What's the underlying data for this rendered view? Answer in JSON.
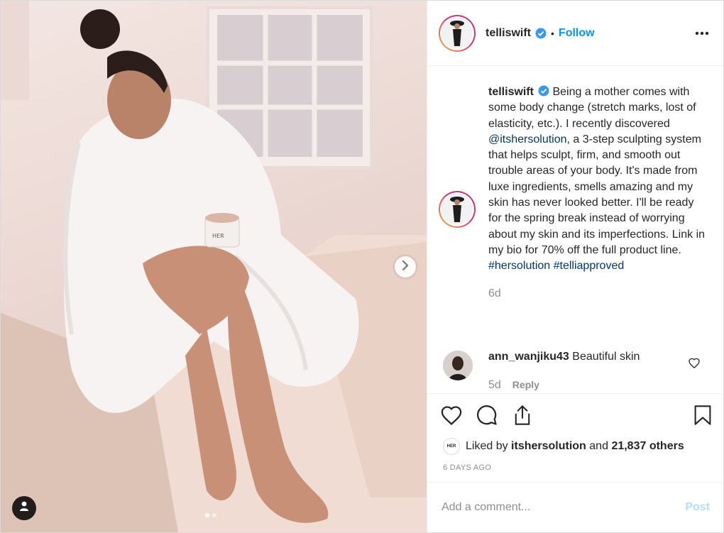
{
  "post": {
    "username": "telliswift",
    "follow_label": "Follow",
    "separator": "•",
    "caption": {
      "username": "telliswift",
      "text_1": " Being a mother comes with some body change (stretch marks, lost of elasticity, etc.). I recently discovered ",
      "mention": "@itshersolution",
      "text_2": ", a 3-step sculpting system that helps sculpt, firm, and smooth out trouble areas of your body. It's made from luxe ingredients, smells amazing and my skin has never looked better. I'll be ready for the spring break instead of worrying about my skin and its imperfections. Link in my bio for 70% off the full product line. ",
      "hashtag_1": "#hersolution",
      "hashtag_2": "#telliapproved",
      "time": "6d"
    },
    "comment": {
      "username": "ann_wanjiku43",
      "text": " Beautiful skin",
      "time": "5d",
      "reply_label": "Reply"
    },
    "likes": {
      "mini_logo": "HER",
      "prefix": "Liked by ",
      "user": "itshersolution",
      "middle": " and ",
      "count": "21,837 others"
    },
    "posted_ago": "6 DAYS AGO",
    "add_comment_placeholder": "Add a comment...",
    "post_label": "Post",
    "jar_label": "HER",
    "carousel": {
      "count": 2,
      "active_index": 1
    }
  },
  "colors": {
    "link": "#0095f6",
    "mention": "#00376b",
    "muted": "#8e8e8e",
    "post_disabled": "#b2dffc"
  },
  "icons": [
    "verified-badge-icon",
    "more-options-icon",
    "heart-icon",
    "comment-icon",
    "share-icon",
    "bookmark-icon",
    "chevron-right-icon",
    "user-tag-icon"
  ]
}
